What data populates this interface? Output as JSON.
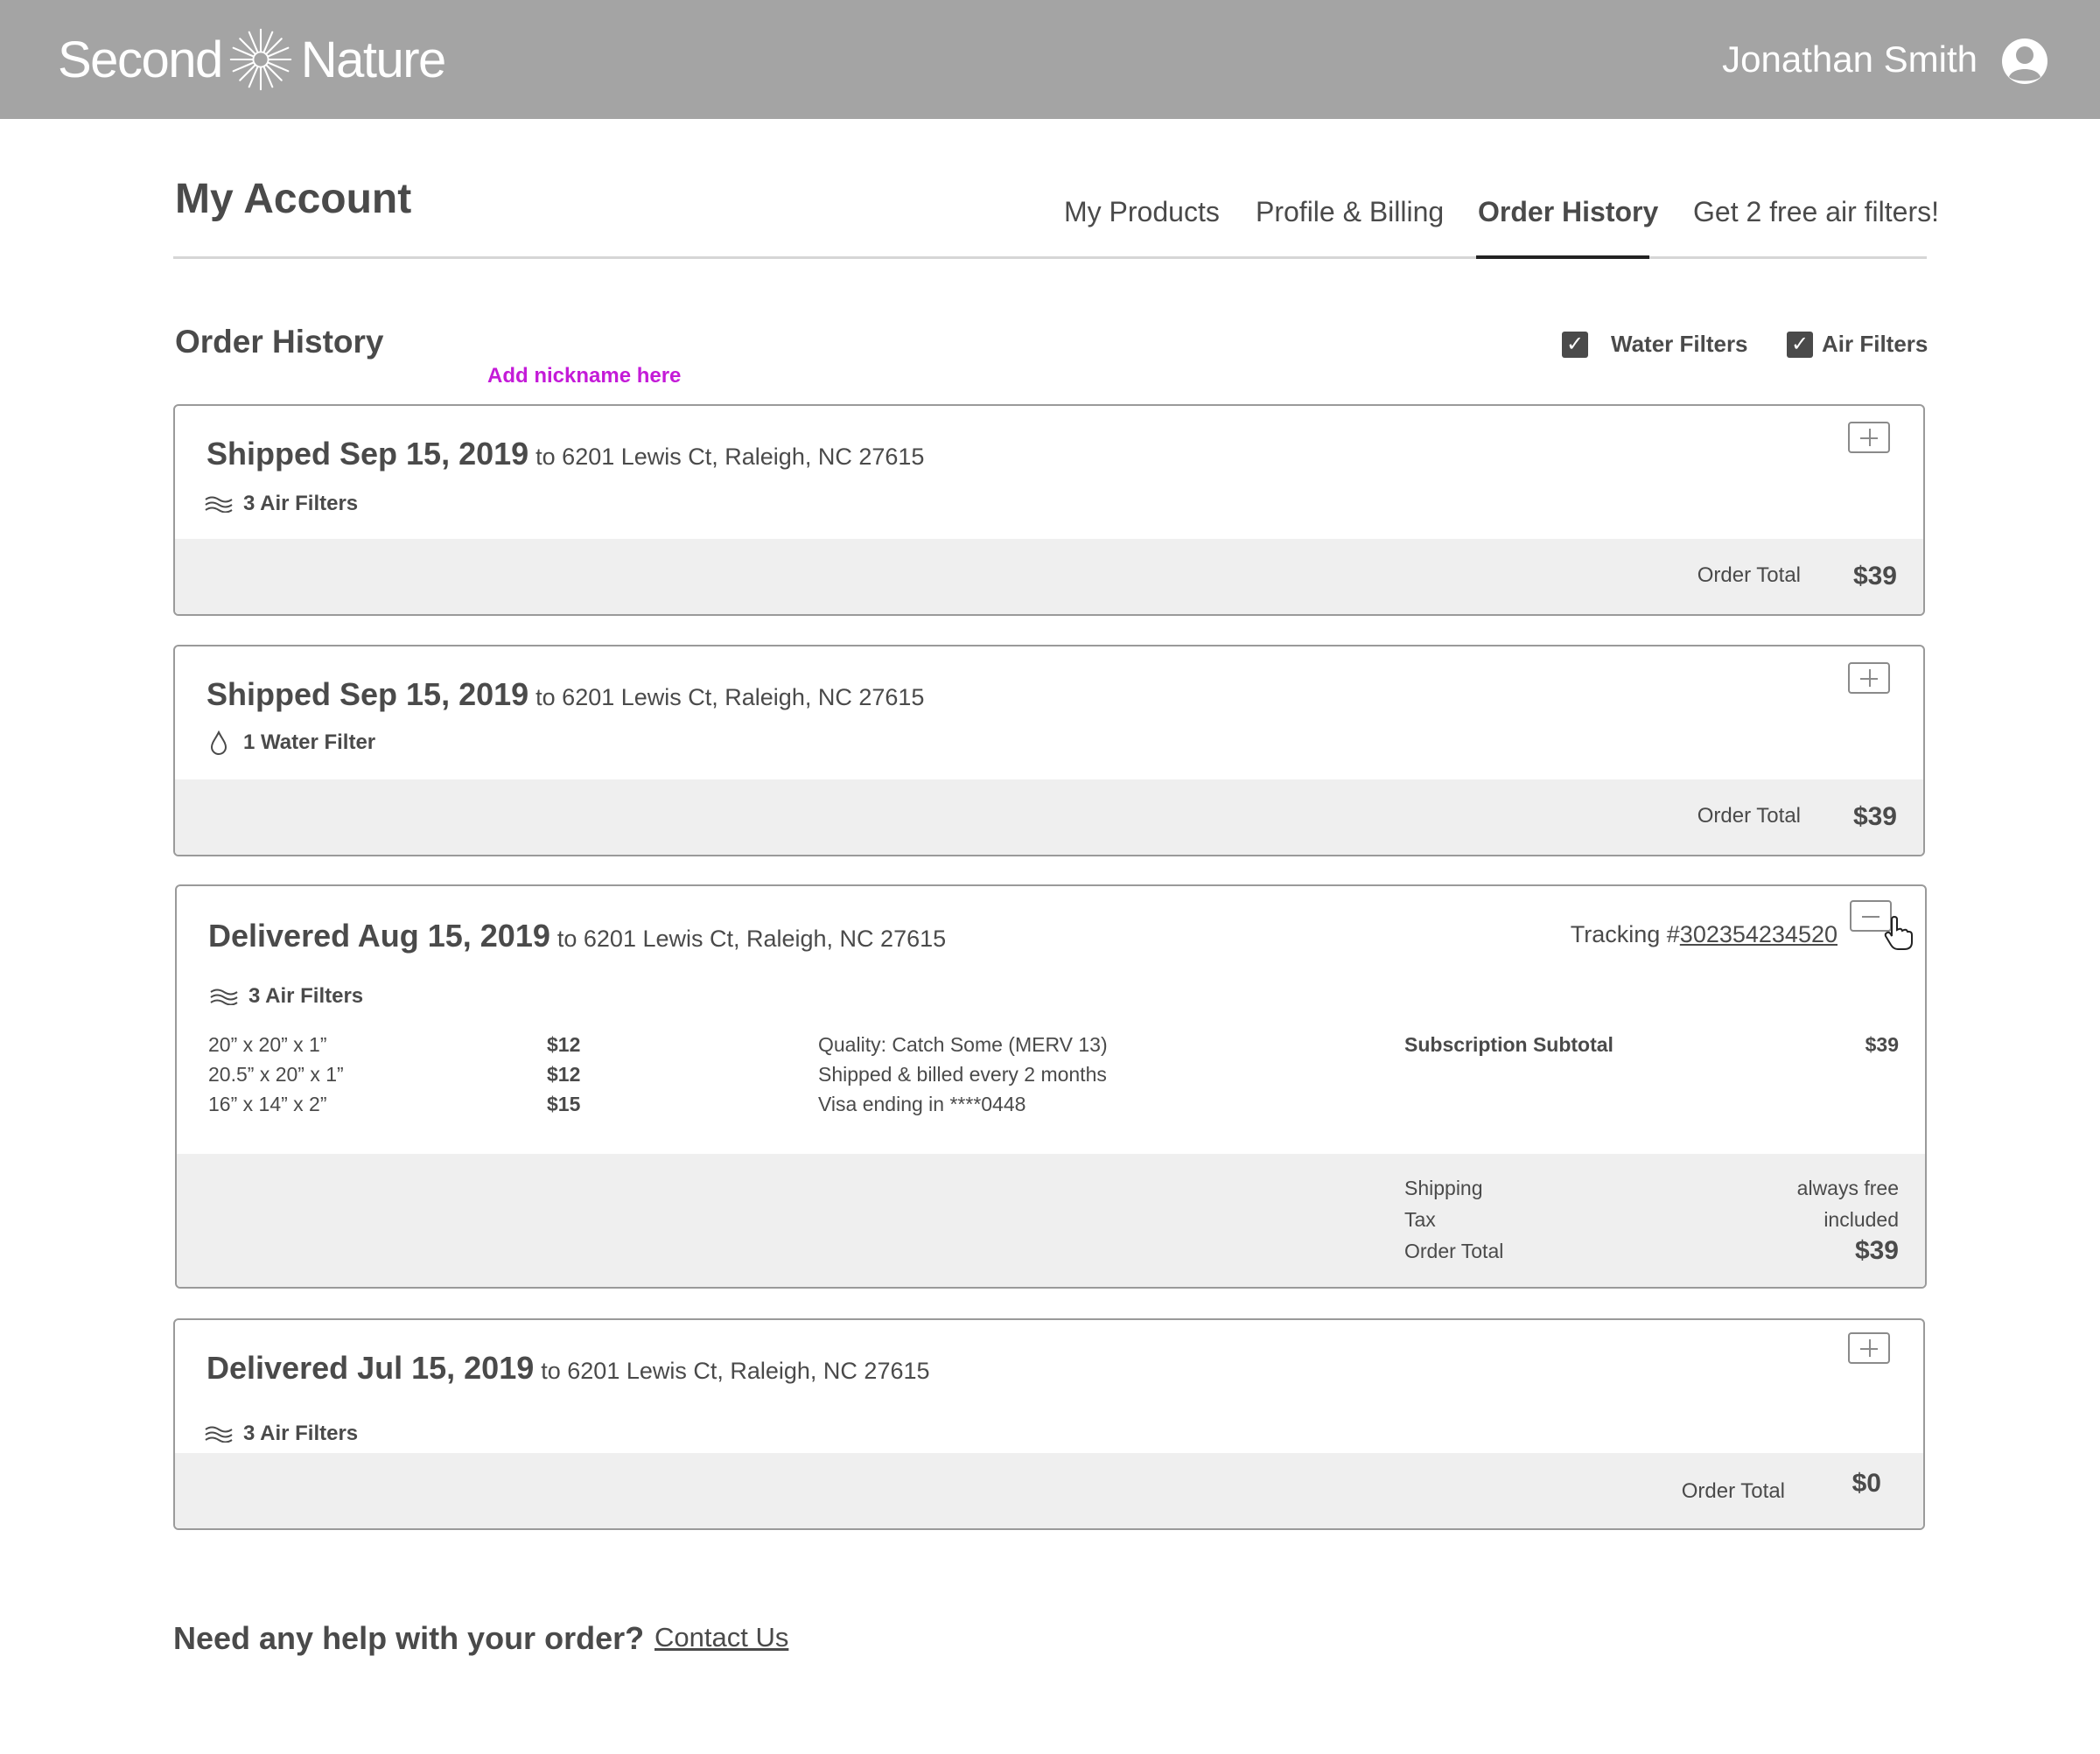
{
  "header": {
    "brand_left": "Second",
    "brand_right": "Nature",
    "user_name": "Jonathan Smith"
  },
  "account": {
    "title": "My Account",
    "tabs": [
      {
        "label": "My Products"
      },
      {
        "label": "Profile & Billing"
      },
      {
        "label": "Order History",
        "active": true
      },
      {
        "label": "Get 2 free air filters!"
      }
    ]
  },
  "history": {
    "title": "Order History",
    "nickname_hint": "Add nickname here",
    "filters": [
      {
        "label": "Water Filters",
        "checked": true
      },
      {
        "label": "Air Filters",
        "checked": true
      }
    ]
  },
  "orders": [
    {
      "status": "Shipped Sep 15, 2019",
      "address": "to 6201 Lewis Ct, Raleigh, NC 27615",
      "items": "3 Air Filters",
      "item_icon": "air-filter-icon",
      "total_label": "Order Total",
      "total": "$39"
    },
    {
      "status": "Shipped Sep 15, 2019",
      "address": "to 6201 Lewis Ct, Raleigh, NC 27615",
      "items": "1 Water Filter",
      "item_icon": "water-drop-icon",
      "total_label": "Order Total",
      "total": "$39"
    },
    {
      "status": "Delivered Aug 15, 2019",
      "address": "to 6201 Lewis Ct, Raleigh, NC 27615",
      "items": "3 Air Filters",
      "item_icon": "air-filter-icon",
      "tracking_label": "Tracking #",
      "tracking_number": "302354234520",
      "expanded": true,
      "line_items": [
        {
          "size": "20” x 20” x 1”",
          "price": "$12"
        },
        {
          "size": "20.5” x 20” x 1”",
          "price": "$12"
        },
        {
          "size": "16” x 14” x 2”",
          "price": "$15"
        }
      ],
      "details": [
        "Quality: Catch Some (MERV 13)",
        "Shipped & billed every 2 months",
        "Visa ending in ****0448"
      ],
      "subtotal_label": "Subscription Subtotal",
      "subtotal": "$39",
      "shipping_label": "Shipping",
      "shipping_value": "always free",
      "tax_label": "Tax",
      "tax_value": "included",
      "total_label": "Order Total",
      "total": "$39"
    },
    {
      "status": "Delivered Jul 15, 2019",
      "address": "to 6201 Lewis Ct, Raleigh, NC 27615",
      "items": "3 Air Filters",
      "item_icon": "air-filter-icon",
      "total_label": "Order Total",
      "total": "$0"
    }
  ],
  "help": {
    "question": "Need any help with your order?",
    "contact_label": "Contact Us"
  },
  "colors": {
    "header_bg": "#a4a4a4",
    "text": "#4a4a4a",
    "nickname_accent": "#c41bd8",
    "footer_bg": "#efefef"
  }
}
